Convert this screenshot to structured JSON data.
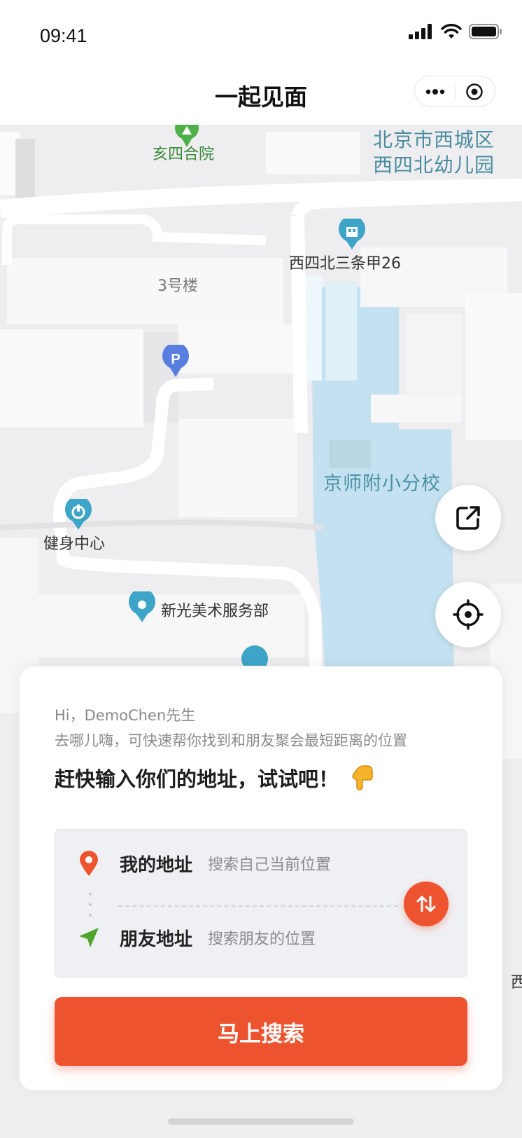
{
  "status_bar": {
    "time": "09:41"
  },
  "nav": {
    "title": "一起见面"
  },
  "map": {
    "pois": {
      "courtyard": "亥四合院",
      "district": "北京市西城区",
      "kindergarten": "西四北幼儿园",
      "address": "西四北三条甲26",
      "building": "3号楼",
      "school": "京师附小分校",
      "gym": "健身中心",
      "art_service": "新光美术服务部",
      "edge_label": "西"
    }
  },
  "card": {
    "greeting": "Hi，DemoChen先生",
    "description": "去哪儿嗨，可快速帮你找到和朋友聚会最短距离的位置",
    "headline": "赶快输入你们的地址，试试吧！",
    "headline_emoji": "👇",
    "my_address": {
      "title": "我的地址",
      "placeholder": "搜索自己当前位置"
    },
    "friend_address": {
      "title": "朋友地址",
      "placeholder": "搜索朋友的位置"
    },
    "search_button": "马上搜索"
  },
  "colors": {
    "accent": "#ee5330",
    "friend_icon": "#4fa62a",
    "water": "#c3e1f0",
    "poi_blue": "#3ea5c8"
  }
}
